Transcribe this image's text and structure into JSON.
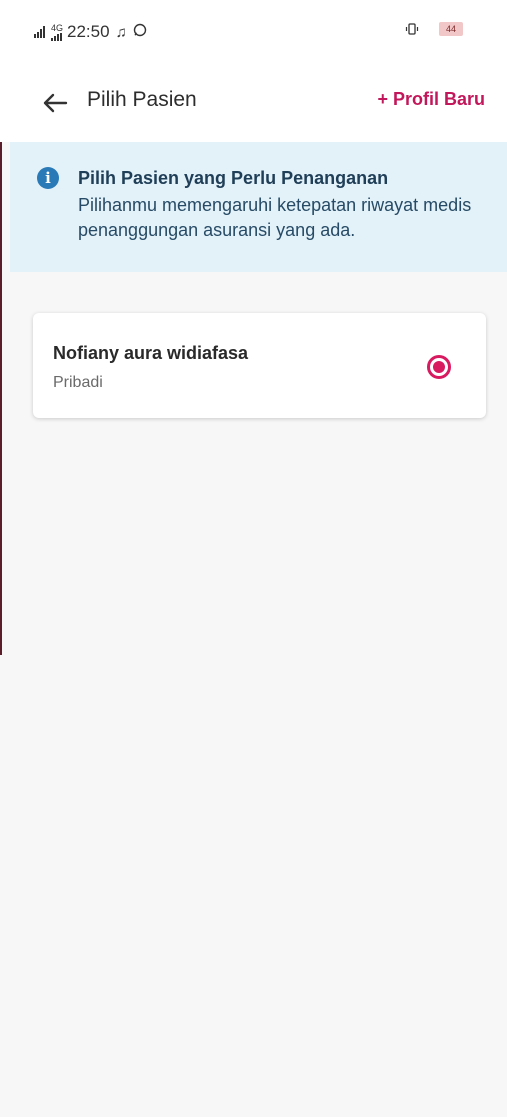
{
  "status_bar": {
    "network": "4G",
    "time": "22:50",
    "battery": "44",
    "icons": [
      "signal-icon",
      "music-icon",
      "whatsapp-icon",
      "vibrate-icon",
      "battery-icon"
    ]
  },
  "header": {
    "back_icon": "arrow-left-icon",
    "title": "Pilih Pasien",
    "new_profile_label": "+ Profil Baru"
  },
  "info_banner": {
    "icon": "info-icon",
    "title": "Pilih Pasien yang Perlu Penanganan",
    "body": "Pilihanmu memengaruhi ketepatan riwayat medis penanggungan asuransi yang ada."
  },
  "patients": [
    {
      "name": "Nofiany aura widiafasa",
      "relation": "Pribadi",
      "selected": true
    }
  ],
  "colors": {
    "accent": "#c2185b",
    "radio": "#d81b60",
    "info_icon": "#2a7ab8",
    "banner_bg": "#e3f1f8"
  }
}
